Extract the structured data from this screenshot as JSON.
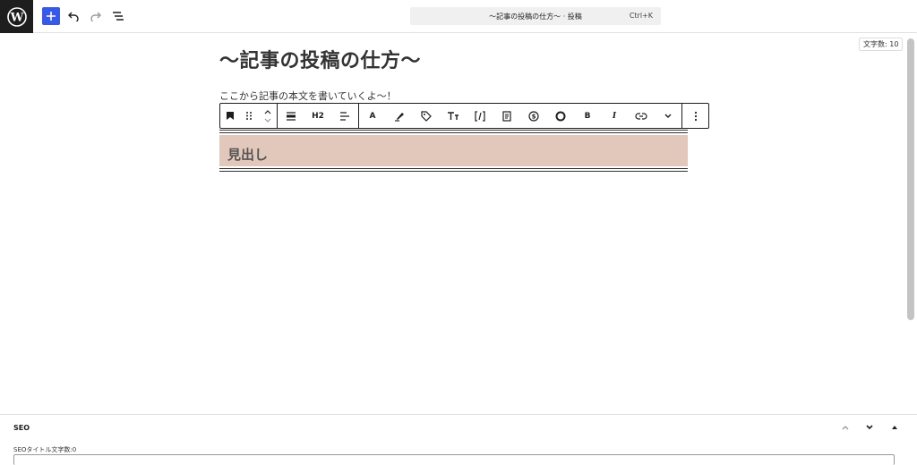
{
  "header": {
    "logo_icon": "wordpress-icon",
    "add_icon": "plus-icon",
    "undo_icon": "undo-icon",
    "redo_icon": "redo-icon",
    "list_view_icon": "list-view-icon",
    "command_bar": {
      "title": "〜記事の投稿の仕方〜 · 投稿",
      "shortcut": "Ctrl+K"
    },
    "accent_color": "#3858e9"
  },
  "editor": {
    "word_count": "文字数: 10",
    "post_title": "〜記事の投稿の仕方〜",
    "paragraph_text": "ここから記事の本文を書いていくよ〜！",
    "block_toolbar": {
      "groups": [
        [
          "bookmark-icon",
          "drag-handle-icon",
          "move-up-down-icon"
        ],
        [
          "align-wide-icon",
          "H2",
          "align-text-icon"
        ],
        [
          "A",
          "highlighter-icon",
          "tag-icon",
          "text-size-icon",
          "shortcode-icon",
          "note-icon",
          "dollar-icon",
          "circle-icon",
          "B",
          "I",
          "link-icon",
          "chevron-down-icon"
        ],
        [
          "more-options-icon"
        ]
      ],
      "heading_level": "H2",
      "font_letter": "A",
      "bold_label": "B",
      "italic_label": "I"
    },
    "heading_block": {
      "text": "見出し",
      "background_color": "#e2c7bb"
    }
  },
  "seo_panel": {
    "title": "SEO",
    "field_label": "SEOタイトル文字数:0",
    "controls": [
      "chevron-up-icon",
      "chevron-down-icon",
      "triangle-up-icon"
    ]
  }
}
